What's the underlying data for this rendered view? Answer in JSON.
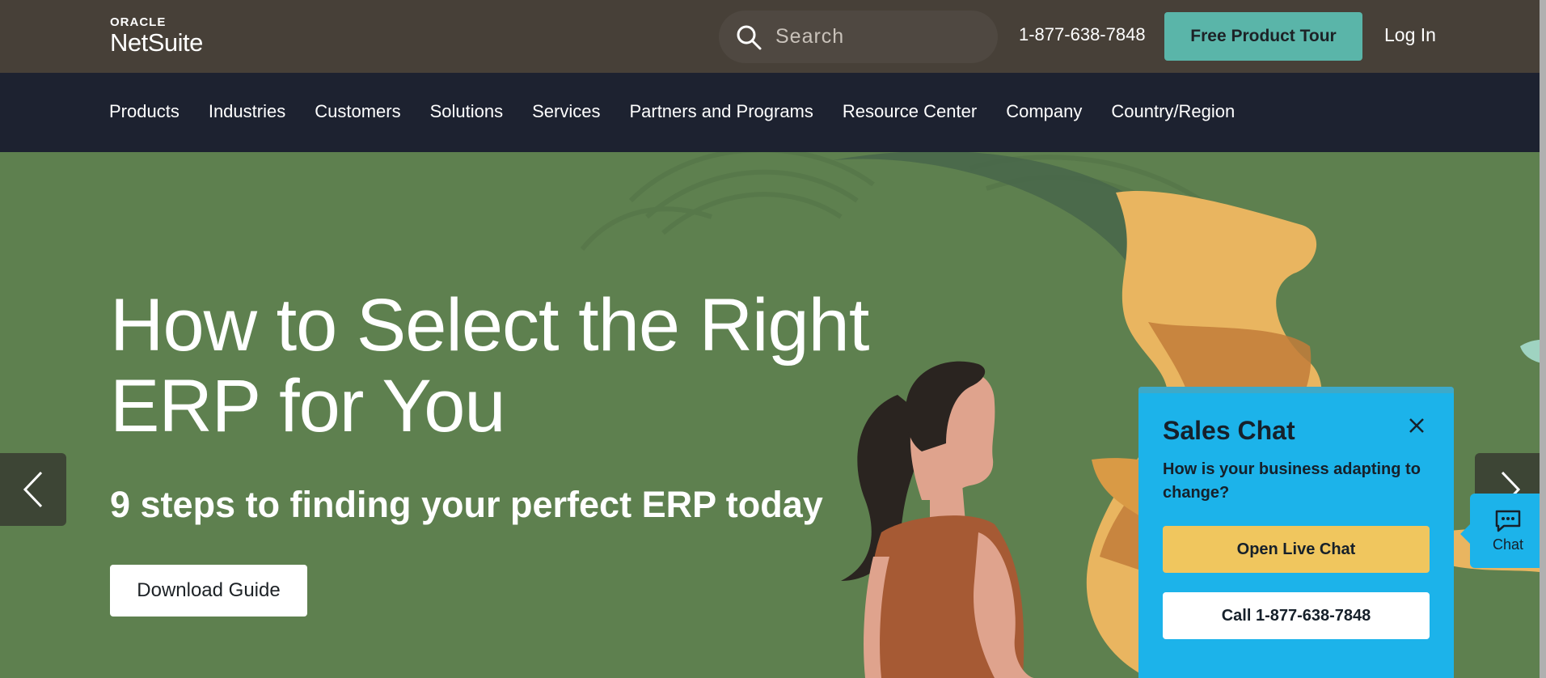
{
  "header": {
    "logo_top": "ORACLE",
    "logo_main": "NetSuite",
    "search_placeholder": "Search",
    "phone": "1-877-638-7848",
    "tour_label": "Free Product Tour",
    "login_label": "Log In"
  },
  "nav": {
    "items": [
      "Products",
      "Industries",
      "Customers",
      "Solutions",
      "Services",
      "Partners and Programs",
      "Resource Center",
      "Company",
      "Country/Region"
    ]
  },
  "hero": {
    "headline_line1": "How to Select the Right",
    "headline_line2": "ERP for You",
    "subhead": "9 steps to finding your perfect ERP today",
    "cta_label": "Download Guide",
    "bg_color": "#5e804f"
  },
  "sales_chat": {
    "title": "Sales Chat",
    "question": "How is your business adapting to change?",
    "live_label": "Open Live Chat",
    "call_label": "Call 1-877-638-7848",
    "bg_color": "#1cb3ea"
  },
  "chat_tab": {
    "label": "Chat"
  },
  "icons": {
    "search": "search-icon",
    "prev": "chevron-left-icon",
    "next": "chevron-right-icon",
    "close": "close-icon",
    "chat": "chat-bubble-icon"
  }
}
